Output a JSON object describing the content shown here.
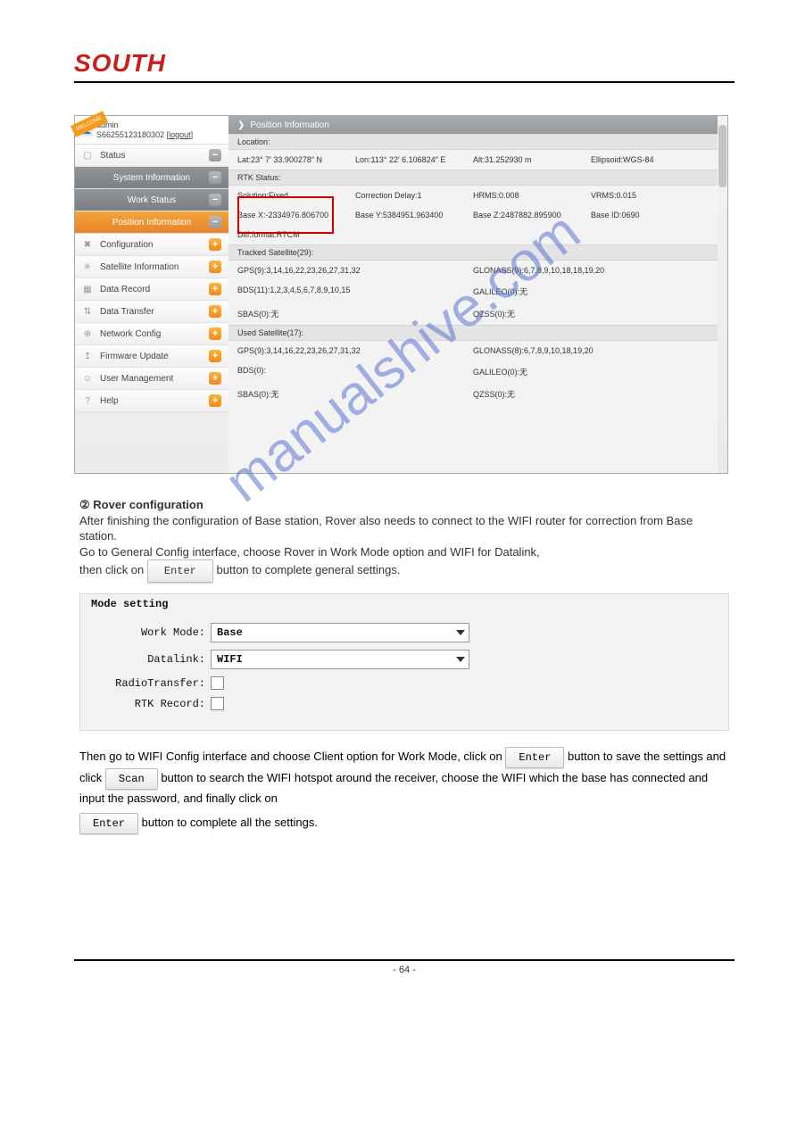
{
  "logo_text": "SOUTH",
  "welcome": {
    "ribbon": "WELCOME",
    "admin": "admin",
    "serial": "S66255123180302",
    "logout": "[logout]"
  },
  "nav": {
    "status": "Status",
    "sysinfo": "System Information",
    "workstatus": "Work Status",
    "posinfo": "Position Information",
    "config": "Configuration",
    "satinfo": "Satellite Information",
    "datarec": "Data Record",
    "datatrans": "Data Transfer",
    "netcfg": "Network Config",
    "fwupd": "Firmware Update",
    "usermgmt": "User Management",
    "help": "Help"
  },
  "main": {
    "title": "Position Information",
    "location_hdr": "Location:",
    "lat": "Lat:23° 7′ 33.900278″ N",
    "lon": "Lon:113° 22′ 6.106824″ E",
    "alt": "Alt:31.252930 m",
    "ellipsoid": "Ellipsoid:WGS-84",
    "rtk_hdr": "RTK Status:",
    "solution": "Solution:Fixed",
    "corrdelay": "Correction Delay:1",
    "hrms": "HRMS:0.008",
    "vrms": "VRMS:0.015",
    "basex": "Base X:-2334976.806700",
    "basey": "Base Y:5384951.963400",
    "basez": "Base Z:2487882.895900",
    "baseid": "Base ID:0690",
    "diff": "Diff.format:RTCM",
    "tracked_hdr": "Tracked Satellite(29):",
    "gps_t": "GPS(9):3,14,16,22,23,26,27,31,32",
    "glonass_t": "GLONASS(9):6,7,8,9,10,18,18,19,20",
    "bds_t": "BDS(11):1,2,3,4,5,6,7,8,9,10,15",
    "galileo_t": "GALILEO(0):无",
    "sbas_t": "SBAS(0):无",
    "qzss_t": "QZSS(0):无",
    "used_hdr": "Used Satellite(17):",
    "gps_u": "GPS(9):3,14,16,22,23,26,27,31,32",
    "glonass_u": "GLONASS(8):6,7,8,9,10,18,19,20",
    "bds_u": "BDS(0):",
    "galileo_u": "GALILEO(0):无",
    "sbas_u": "SBAS(0):无",
    "qzss_u": "QZSS(0):无"
  },
  "body": {
    "p1a": "② Rover configuration",
    "p1b": "After finishing the configuration of Base station, Rover also needs to connect to the WIFI router for correction from Base station.",
    "p1c": "Go to General Config interface, choose Rover in Work Mode option and WIFI for Datalink,",
    "p1d": "then click on ",
    "p1e": " button to complete general settings.",
    "enter1": "Enter"
  },
  "mode": {
    "title": "Mode setting",
    "workmode_l": "Work Mode:",
    "workmode_v": "Base",
    "datalink_l": "Datalink:",
    "datalink_v": "WIFI",
    "radio_l": "RadioTransfer:",
    "rtk_l": "RTK Record:"
  },
  "steps": {
    "s1a": "Then go to WIFI Config interface and choose Client option for Work Mode, click on ",
    "s1b": " button to save the settings and click ",
    "s1c": " button to search the WIFI hotspot around the receiver, choose the WIFI which the base has connected and input the password, and finally click on ",
    "s1d": " button to complete all the settings.",
    "enter2": "Enter",
    "scan": "Scan",
    "enter3": "Enter"
  },
  "footer": "- 64 -",
  "watermark": "manualshive.com"
}
